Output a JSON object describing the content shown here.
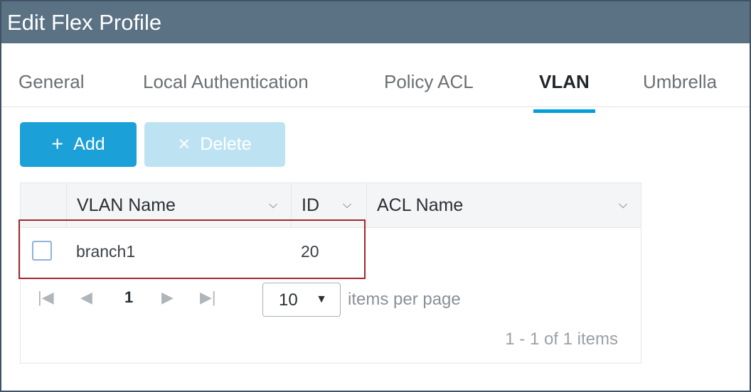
{
  "window": {
    "title": "Edit Flex Profile"
  },
  "tabs": [
    {
      "label": "General"
    },
    {
      "label": "Local Authentication"
    },
    {
      "label": "Policy ACL"
    },
    {
      "label": "VLAN"
    },
    {
      "label": "Umbrella"
    }
  ],
  "active_tab": "VLAN",
  "toolbar": {
    "add_label": "Add",
    "add_icon": "plus-icon",
    "delete_label": "Delete",
    "delete_icon": "x-icon"
  },
  "table": {
    "columns": [
      {
        "label": "VLAN Name"
      },
      {
        "label": "ID"
      },
      {
        "label": "ACL Name"
      }
    ],
    "rows": [
      {
        "vlan_name": "branch1",
        "id": "20",
        "acl_name": ""
      }
    ]
  },
  "pagination": {
    "page": "1",
    "per_page": "10",
    "per_page_label": "items per page",
    "summary": "1 - 1 of 1 items"
  },
  "colors": {
    "titlebar": "#5b7184",
    "accent": "#049fd9",
    "add_button": "#1ba0d7",
    "delete_button_disabled": "#bde3f3",
    "highlight_border": "#a4262c"
  }
}
